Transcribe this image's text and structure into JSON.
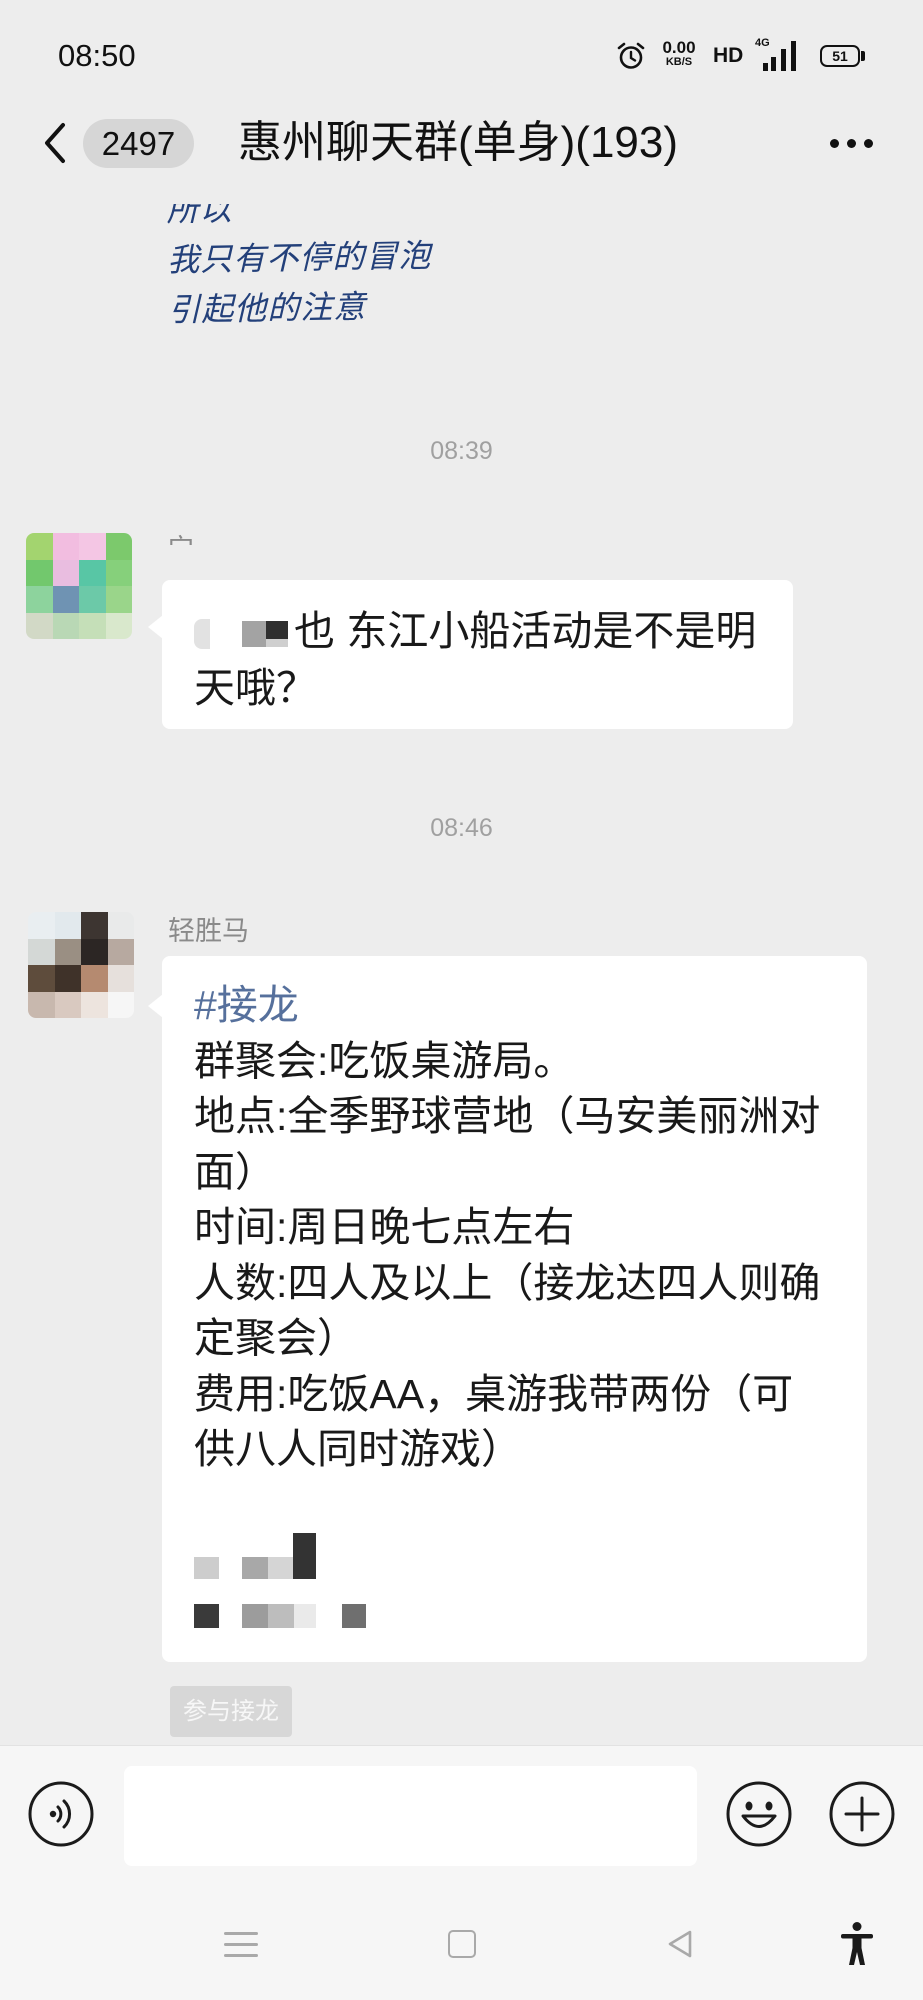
{
  "status_bar": {
    "time": "08:50",
    "alarm_icon": "alarm-clock-icon",
    "net_speed": "0.00",
    "net_speed_unit": "KB/S",
    "hd_label": "HD",
    "network_type": "4G",
    "signal_icon": "signal-bars-icon",
    "battery_level": "51"
  },
  "header": {
    "back_icon": "chevron-left-icon",
    "unread_count": "2497",
    "title": "惠州聊天群(单身)(193)",
    "more_icon": "more-dots-icon"
  },
  "chat": {
    "sticker_lines": [
      "所以",
      "我只有不停的冒泡",
      "引起他的注意"
    ],
    "messages": [
      {
        "timestamp": "08:39",
        "sender": "宀",
        "text": "也 东江小船活动是不是明天哦？"
      },
      {
        "timestamp": "08:46",
        "sender": "轻胜马",
        "tag": "#接龙",
        "lines": [
          "群聚会:吃饭桌游局。",
          "地点:全季野球营地（马安美丽洲对面）",
          "时间:周日晚七点左右",
          "人数:四人及以上（接龙达四人则确定聚会）",
          "费用:吃饭AA，桌游我带两份（可供八人同时游戏）"
        ],
        "action_button": "参与接龙"
      }
    ]
  },
  "input_bar": {
    "voice_icon": "voice-icon",
    "emoji_icon": "emoji-icon",
    "plus_icon": "plus-icon"
  },
  "nav_bar": {
    "menu_icon": "menu-icon",
    "home_icon": "home-square-icon",
    "back_icon": "back-triangle-icon",
    "accessibility_icon": "accessibility-icon"
  },
  "colors": {
    "background": "#ededed",
    "bubble": "#ffffff",
    "tag_blue": "#56709c",
    "text": "#191919",
    "timestamp": "#a0a0a0",
    "input_bar": "#f6f6f6"
  }
}
